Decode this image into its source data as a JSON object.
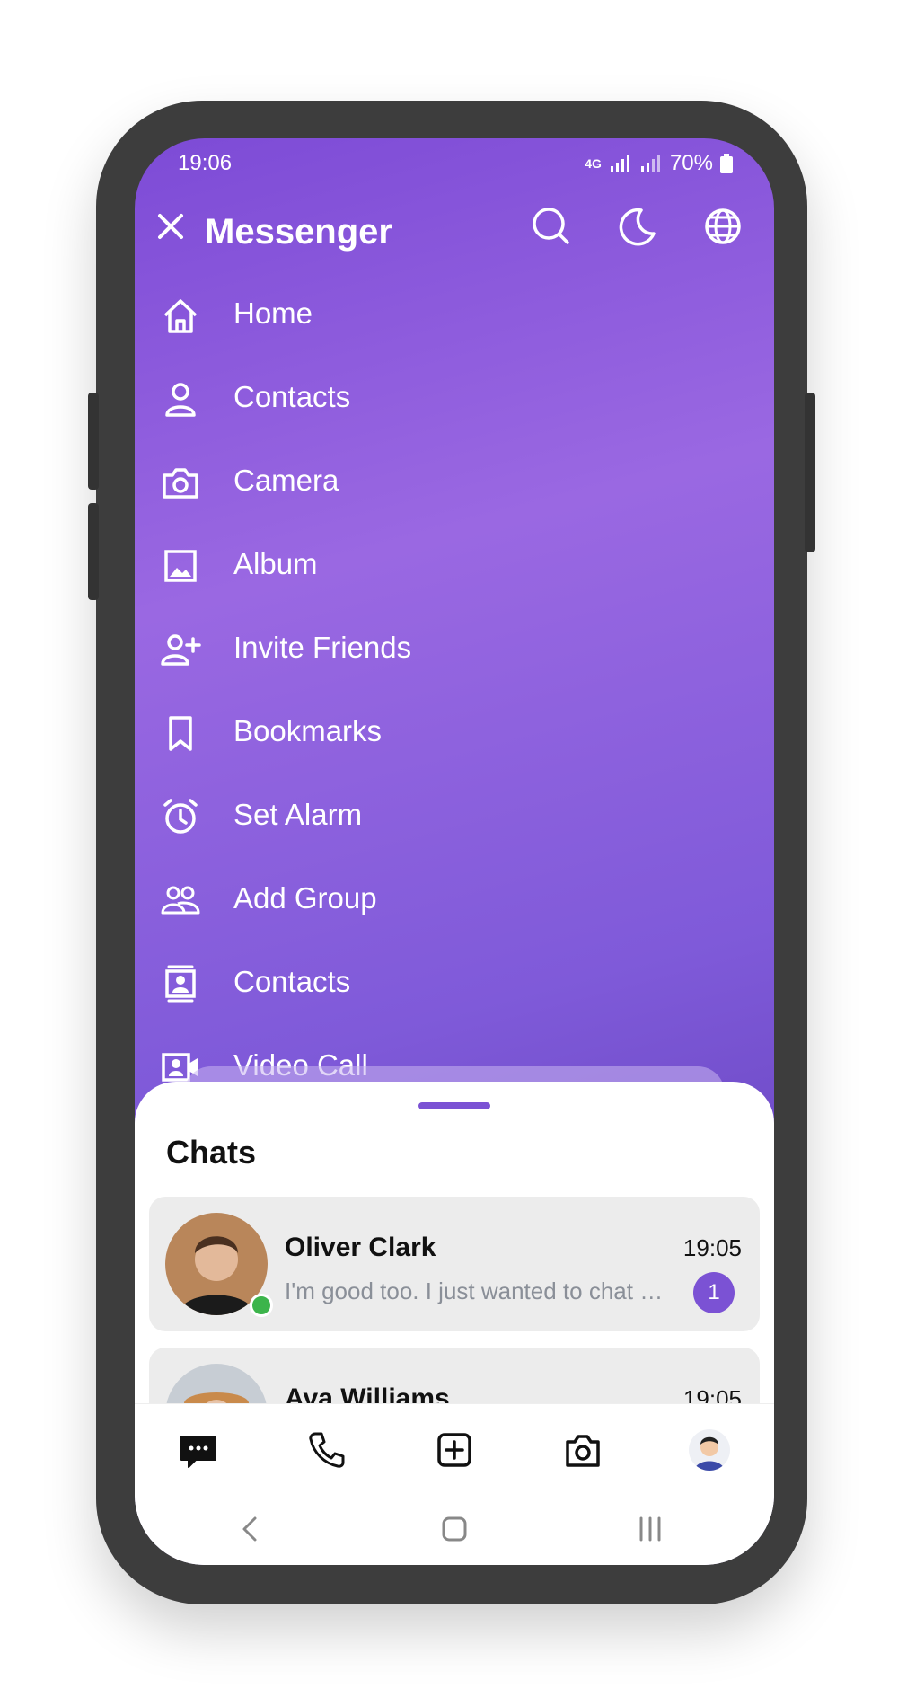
{
  "status": {
    "time": "19:06",
    "network": "4G",
    "battery": "70%"
  },
  "header": {
    "title": "Messenger"
  },
  "menu": [
    {
      "label": "Home",
      "icon": "home-icon"
    },
    {
      "label": "Contacts",
      "icon": "person-icon"
    },
    {
      "label": "Camera",
      "icon": "camera-icon"
    },
    {
      "label": "Album",
      "icon": "image-icon"
    },
    {
      "label": "Invite Friends",
      "icon": "person-add-icon"
    },
    {
      "label": "Bookmarks",
      "icon": "bookmark-icon"
    },
    {
      "label": "Set Alarm",
      "icon": "alarm-icon"
    },
    {
      "label": "Add Group",
      "icon": "group-icon"
    },
    {
      "label": "Contacts",
      "icon": "contact-card-icon"
    },
    {
      "label": "Video Call",
      "icon": "video-call-icon"
    }
  ],
  "chats": {
    "title": "Chats",
    "items": [
      {
        "name": "Oliver Clark",
        "preview": "I'm good too. I just wanted to chat …",
        "time": "19:05",
        "unread": "1"
      },
      {
        "name": "Ava Williams",
        "time": "19:05"
      }
    ]
  },
  "colors": {
    "accent": "#7b52d4",
    "online": "#3cb44b"
  }
}
